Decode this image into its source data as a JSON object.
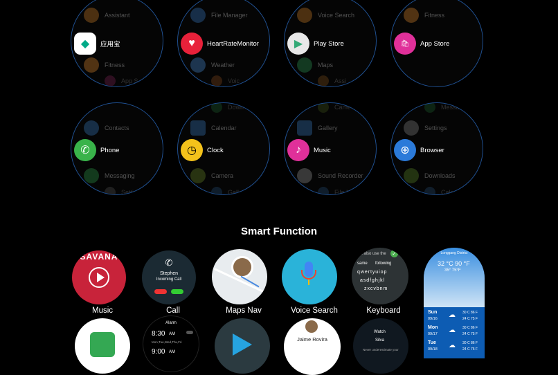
{
  "watches": [
    {
      "id": "w1",
      "top": "Assistant",
      "center": "应用宝",
      "bottom": "Fitness",
      "peek_bottom": "App S"
    },
    {
      "id": "w2",
      "top": "File Manager",
      "center": "HeartRateMonitor",
      "bottom": "Weather",
      "peek_bottom": "Voic"
    },
    {
      "id": "w3",
      "top": "Voice Search",
      "center": "Play Store",
      "bottom": "Maps",
      "peek_bottom": "Assi"
    },
    {
      "id": "w4",
      "top": "Fitness",
      "center": "App Store",
      "bottom": "",
      "peek_bottom": ""
    },
    {
      "id": "w5",
      "top": "Contacts",
      "center": "Phone",
      "bottom": "Messaging",
      "peek_top": "",
      "peek_bottom": "Setti"
    },
    {
      "id": "w6",
      "top": "Calendar",
      "center": "Clock",
      "bottom": "Camera",
      "peek_top": "Down",
      "peek_bottom": "Galle"
    },
    {
      "id": "w7",
      "top": "Gallery",
      "center": "Music",
      "bottom": "Sound Recorder",
      "peek_top": "Came",
      "peek_bottom": "File M"
    },
    {
      "id": "w8",
      "top": "Settings",
      "center": "Browser",
      "bottom": "Downloads",
      "peek_top": "Messa",
      "peek_bottom": "Calc"
    }
  ],
  "section_title": "Smart Function",
  "smart_functions": [
    {
      "label": "Music",
      "banner": "SAVANA"
    },
    {
      "label": "Call",
      "caller": "Stephen",
      "status": "Incoming Call"
    },
    {
      "label": "Maps Nav"
    },
    {
      "label": "Voice Search"
    },
    {
      "label": "Keyboard",
      "hint": "can also use the",
      "word1": "same",
      "word2": "following",
      "keys": "q w e r t y u i o p",
      "keys2": "a s d f g h j k l",
      "keys3": "z x c v b n m"
    },
    {
      "location": "Longgang District",
      "temp": "32 °C 90 °F",
      "today": "35° 75°F",
      "days": [
        {
          "day": "Sun",
          "date": "09/16",
          "hi": "30 C 86 F",
          "lo": "24 C 75 F"
        },
        {
          "day": "Mon",
          "date": "09/17",
          "hi": "30 C 86 F",
          "lo": "24 C 75 F"
        },
        {
          "day": "Tue",
          "date": "09/18",
          "hi": "30 C 86 F",
          "lo": "24 C 75 F"
        }
      ]
    }
  ],
  "row2": {
    "alarm_title": "Alarm",
    "alarm_time1": "8:30",
    "alarm_ampm1": "AM",
    "alarm_days": "Mon,Tue,Wed,Thu,Fri",
    "alarm_time2": "9:00",
    "alarm_ampm2": "AM",
    "contact_name": "Jaime Rovira",
    "watch_brand": "Watch",
    "watch_user": "Silva",
    "watch_msg": "Never underestimate your"
  },
  "colors": {
    "ring": "#1f4f8f",
    "bg": "#000000"
  }
}
